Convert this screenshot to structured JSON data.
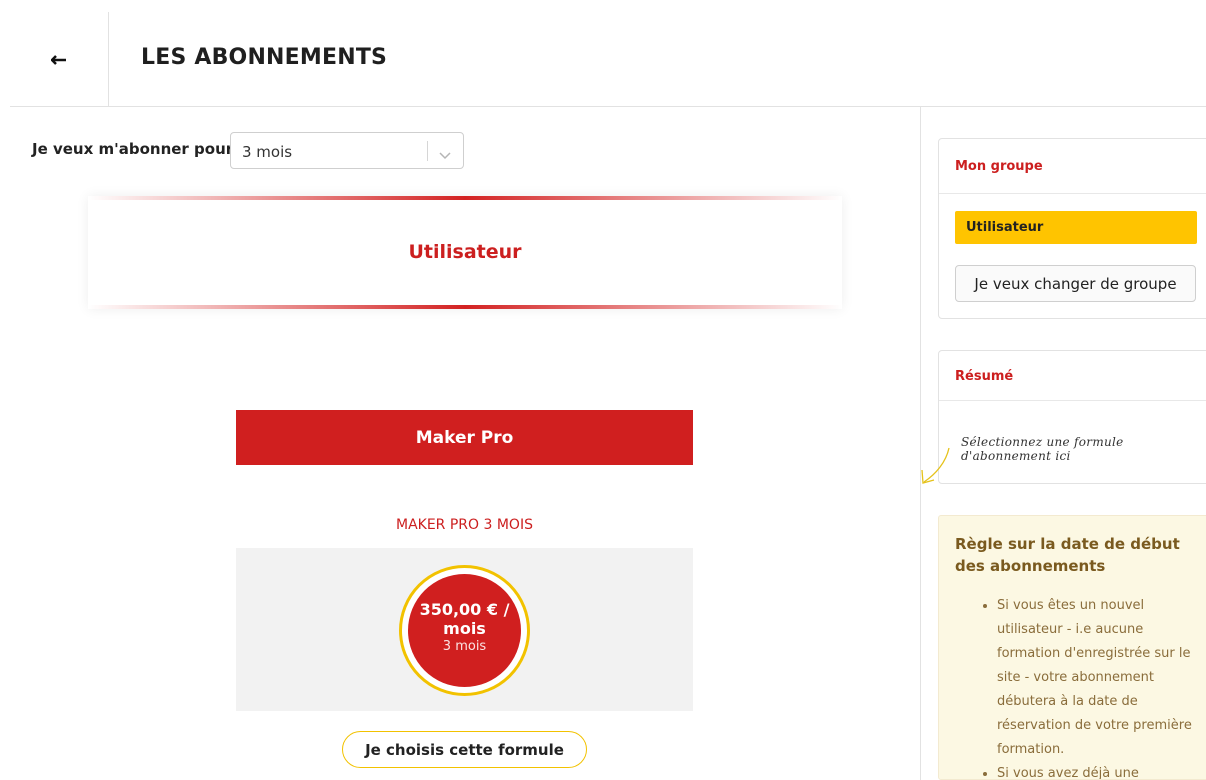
{
  "header": {
    "back_icon": "arrow-left-icon",
    "title": "LES ABONNEMENTS"
  },
  "subscription": {
    "label": "Je veux m'abonner pour",
    "duration_value": "3 mois",
    "dropdown_icon": "chevron-down-icon"
  },
  "group_banner": {
    "name": "Utilisateur"
  },
  "plan": {
    "header": "Maker Pro",
    "subtitle": "MAKER PRO 3 MOIS",
    "price": "350,00 € / mois",
    "duration": "3 mois",
    "choose_label": "Je choisis cette formule"
  },
  "sidebar": {
    "group_card": {
      "title": "Mon groupe",
      "current_group": "Utilisateur",
      "change_label": "Je veux changer de groupe"
    },
    "summary_card": {
      "title": "Résumé",
      "hint": "Sélectionnez une formule d'abonnement ici"
    },
    "rule_box": {
      "title": "Règle sur la date de début des abonnements",
      "items": [
        "Si vous êtes un nouvel utilisateur - i.e aucune formation d'enregistrée sur le site - votre abonnement débutera à la date de réservation de votre première formation.",
        "Si vous avez déjà une"
      ]
    }
  },
  "colors": {
    "brand_red": "#d01f1f",
    "accent_yellow": "#ffc400",
    "rule_bg": "#fcf8e3",
    "rule_text": "#8a6d3b"
  }
}
